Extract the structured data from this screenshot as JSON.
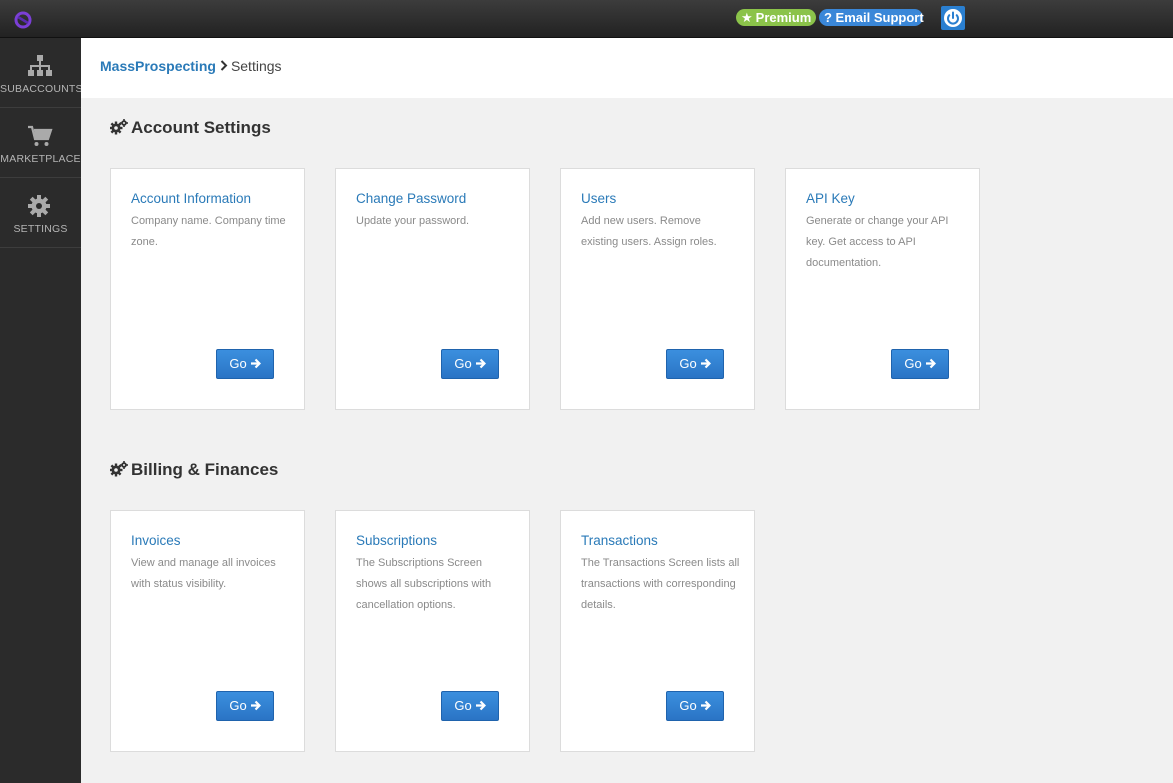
{
  "topbar": {
    "premium_label": "Premium",
    "support_label": "? Email Support",
    "icons": {
      "logo": "logo-icon",
      "star": "star-icon",
      "power": "power-icon"
    }
  },
  "sidebar": {
    "items": [
      {
        "label": "SUBACCOUNTS",
        "icon": "sitemap-icon"
      },
      {
        "label": "MARKETPLACE",
        "icon": "cart-icon"
      },
      {
        "label": "SETTINGS",
        "icon": "gear-icon"
      }
    ]
  },
  "breadcrumb": {
    "root": "MassProspecting",
    "current": "Settings"
  },
  "sections": [
    {
      "title": "Account Settings",
      "cards": [
        {
          "title": "Account Information",
          "desc": "Company name. Company time zone.",
          "button": "Go"
        },
        {
          "title": "Change Password",
          "desc": "Update your password.",
          "button": "Go"
        },
        {
          "title": "Users",
          "desc": "Add new users. Remove existing users. Assign roles.",
          "button": "Go"
        },
        {
          "title": "API Key",
          "desc": "Generate or change your API key. Get access to API documentation.",
          "button": "Go"
        }
      ]
    },
    {
      "title": "Billing & Finances",
      "cards": [
        {
          "title": "Invoices",
          "desc": "View and manage all invoices with status visibility.",
          "button": "Go"
        },
        {
          "title": "Subscriptions",
          "desc": "The Subscriptions Screen shows all subscriptions with cancellation options.",
          "button": "Go"
        },
        {
          "title": "Transactions",
          "desc": "The Transactions Screen lists all transactions with corresponding details.",
          "button": "Go"
        }
      ]
    }
  ],
  "colors": {
    "accent": "#2a7ab8",
    "button": "#2f80d0",
    "premium": "#8bc34a",
    "support": "#3a87d8"
  }
}
